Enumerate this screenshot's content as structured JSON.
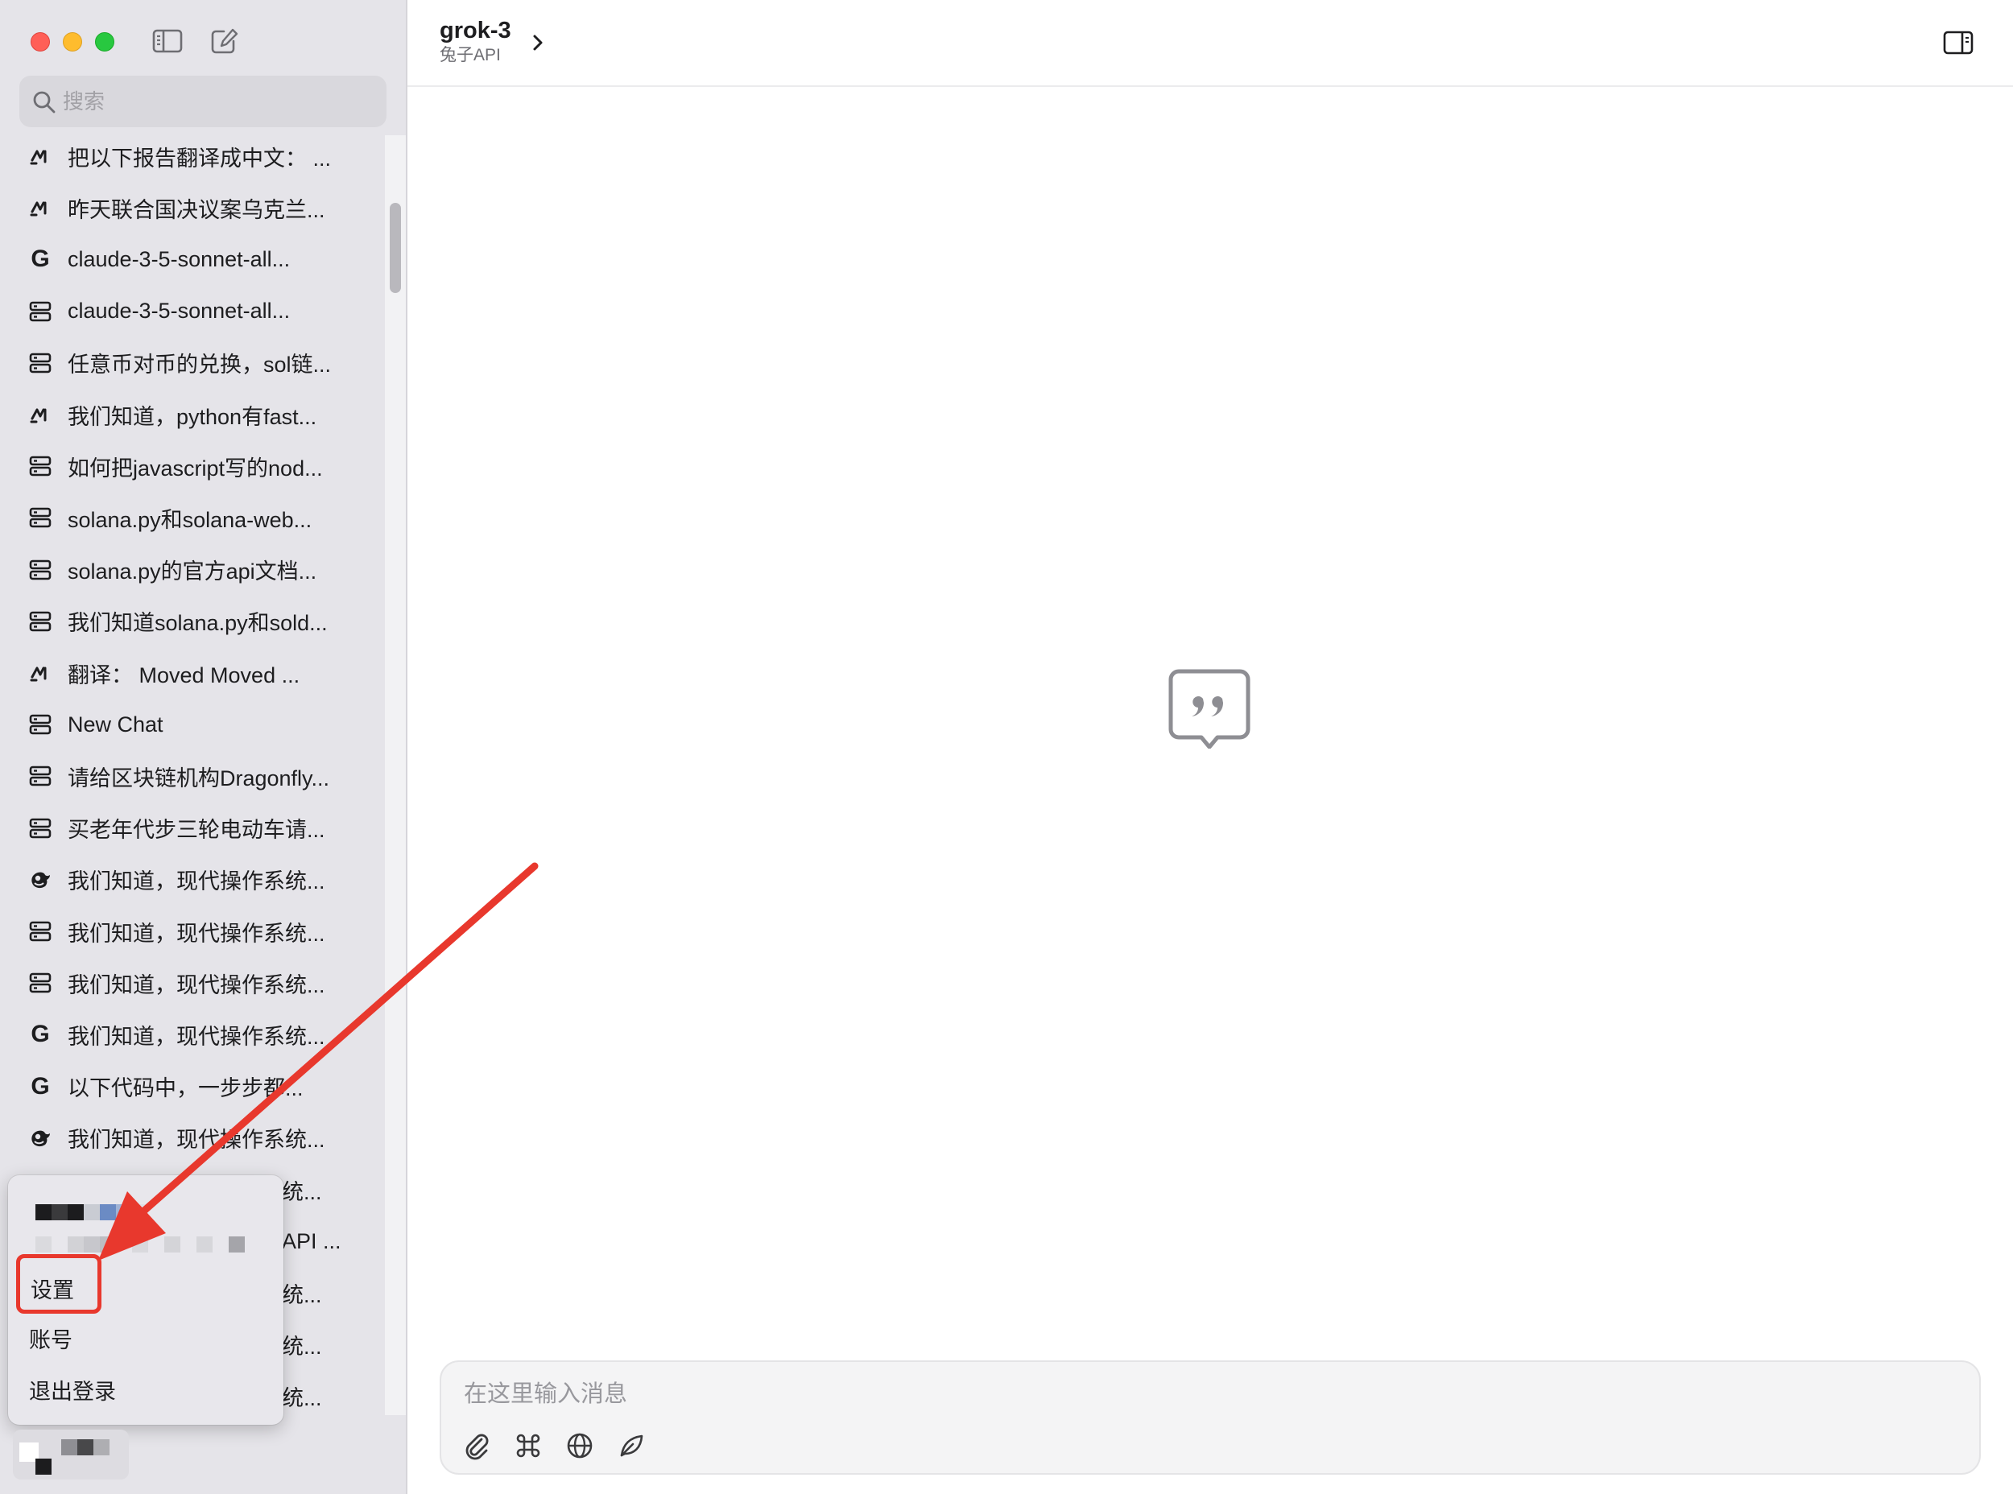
{
  "sidebar": {
    "search_placeholder": "搜索",
    "chats": [
      {
        "label": "把以下报告翻译成中文：  ...",
        "icon": "mistral-icon"
      },
      {
        "label": "昨天联合国决议案乌克兰...",
        "icon": "mistral-icon"
      },
      {
        "label": "claude-3-5-sonnet-all...",
        "icon": "google-icon"
      },
      {
        "label": "claude-3-5-sonnet-all...",
        "icon": "server-icon"
      },
      {
        "label": "任意币对币的兑换，sol链...",
        "icon": "server-icon"
      },
      {
        "label": "我们知道，python有fast...",
        "icon": "mistral-icon"
      },
      {
        "label": "如何把javascript写的nod...",
        "icon": "server-icon"
      },
      {
        "label": "solana.py和solana-web...",
        "icon": "server-icon"
      },
      {
        "label": "solana.py的官方api文档...",
        "icon": "server-icon"
      },
      {
        "label": "我们知道solana.py和sold...",
        "icon": "server-icon"
      },
      {
        "label": "翻译：  Moved Moved     ...",
        "icon": "mistral-icon"
      },
      {
        "label": "New Chat",
        "icon": "server-icon"
      },
      {
        "label": "请给区块链机构Dragonfly...",
        "icon": "server-icon"
      },
      {
        "label": "买老年代步三轮电动车请...",
        "icon": "server-icon"
      },
      {
        "label": "我们知道，现代操作系统...",
        "icon": "deepseek-icon"
      },
      {
        "label": "我们知道，现代操作系统...",
        "icon": "server-icon"
      },
      {
        "label": "我们知道，现代操作系统...",
        "icon": "server-icon"
      },
      {
        "label": "我们知道，现代操作系统...",
        "icon": "google-icon"
      },
      {
        "label": "以下代码中，一步步都...",
        "icon": "google-icon"
      },
      {
        "label": "我们知道，现代操作系统...",
        "icon": "deepseek-icon"
      },
      {
        "label": "统...",
        "icon": "none"
      },
      {
        "label": "API ...",
        "icon": "none"
      },
      {
        "label": "统...",
        "icon": "none"
      },
      {
        "label": "统...",
        "icon": "none"
      },
      {
        "label": "统...",
        "icon": "none"
      }
    ]
  },
  "popup_menu": {
    "items": [
      {
        "label": "设置"
      },
      {
        "label": "账号"
      },
      {
        "label": "退出登录"
      }
    ]
  },
  "header": {
    "model_name": "grok-3",
    "provider": "兔子API"
  },
  "composer": {
    "placeholder": "在这里输入消息"
  },
  "colors": {
    "annotation_red": "#e8382d",
    "sidebar_bg": "#e5e4e9"
  }
}
